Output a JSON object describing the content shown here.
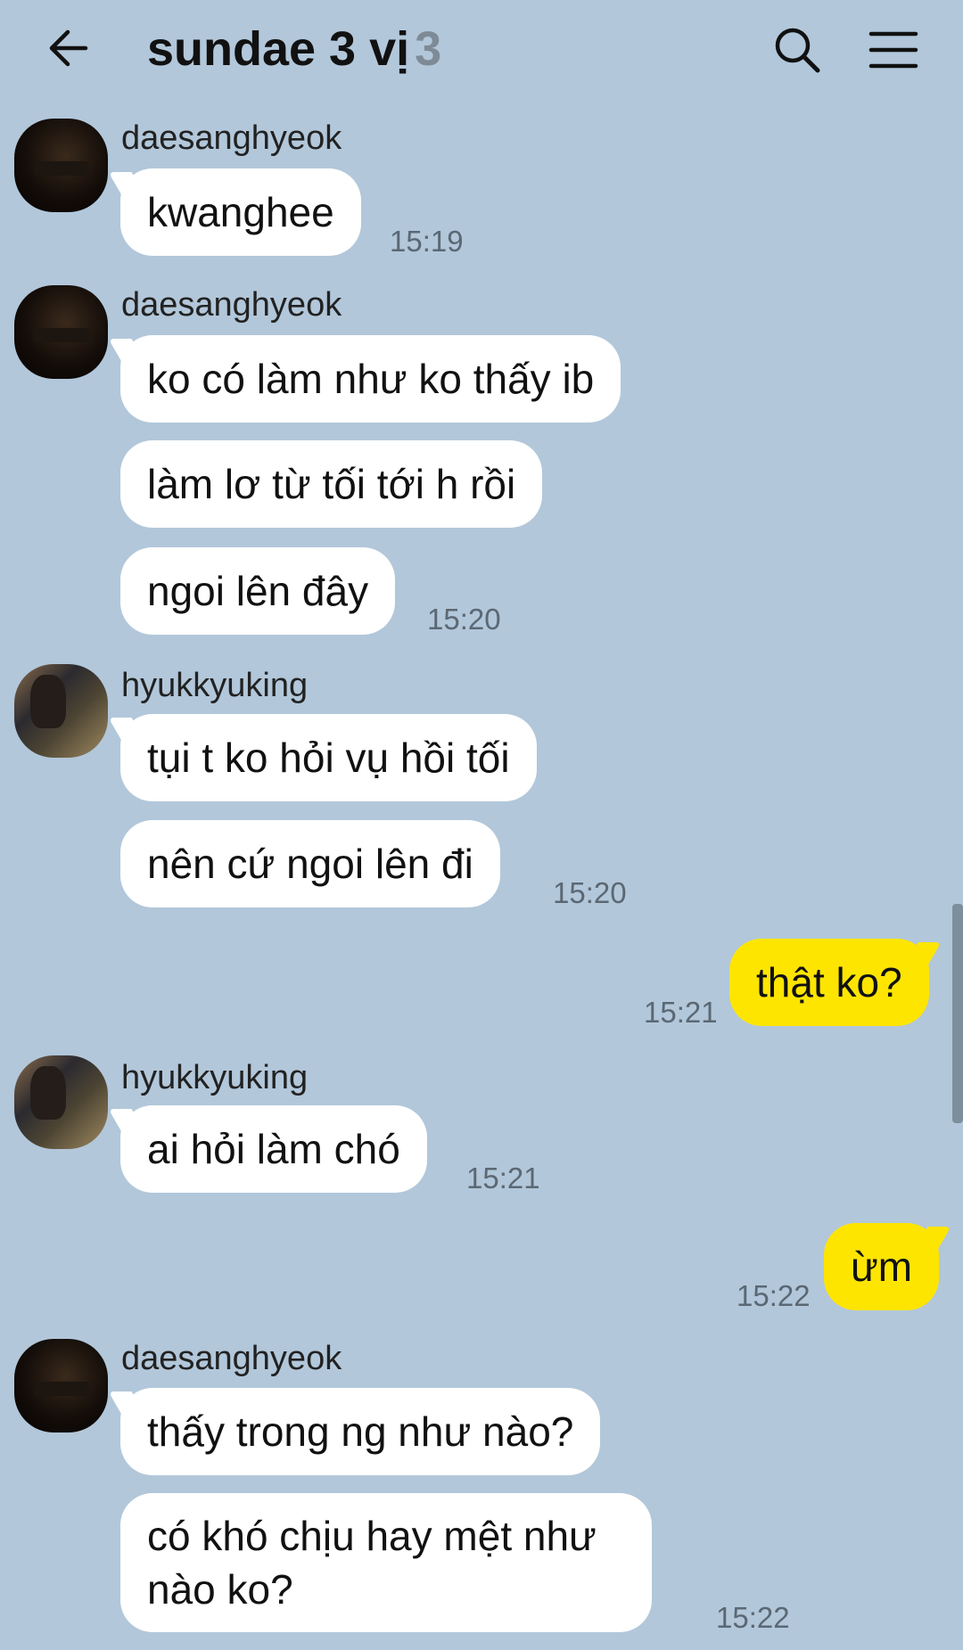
{
  "header": {
    "title": "sundae 3 vị",
    "member_count": "3",
    "back_icon": "arrow-left-icon",
    "search_icon": "search-icon",
    "menu_icon": "hamburger-menu-icon"
  },
  "colors": {
    "background": "#b2c7da",
    "incoming_bubble": "#ffffff",
    "outgoing_bubble": "#fee500",
    "time_text": "#5b6874"
  },
  "messages": [
    {
      "sender": "daesanghyeok",
      "lines": [
        "kwanghee"
      ],
      "time": "15:19"
    },
    {
      "sender": "daesanghyeok",
      "lines": [
        "ko có làm như ko thấy ib",
        "làm lơ từ tối tới h rồi",
        "ngoi lên đây"
      ],
      "time": "15:20"
    },
    {
      "sender": "hyukkyuking",
      "lines": [
        "tụi t ko hỏi vụ hồi tối",
        "nên cứ ngoi lên đi"
      ],
      "time": "15:20"
    },
    {
      "sender": "me",
      "lines": [
        "thật ko?"
      ],
      "time": "15:21"
    },
    {
      "sender": "hyukkyuking",
      "lines": [
        "ai hỏi làm chó"
      ],
      "time": "15:21"
    },
    {
      "sender": "me",
      "lines": [
        "ừm"
      ],
      "time": "15:22"
    },
    {
      "sender": "daesanghyeok",
      "lines": [
        "thấy trong ng như nào?",
        "có khó chịu hay mệt như nào ko?"
      ],
      "time": "15:22"
    }
  ]
}
